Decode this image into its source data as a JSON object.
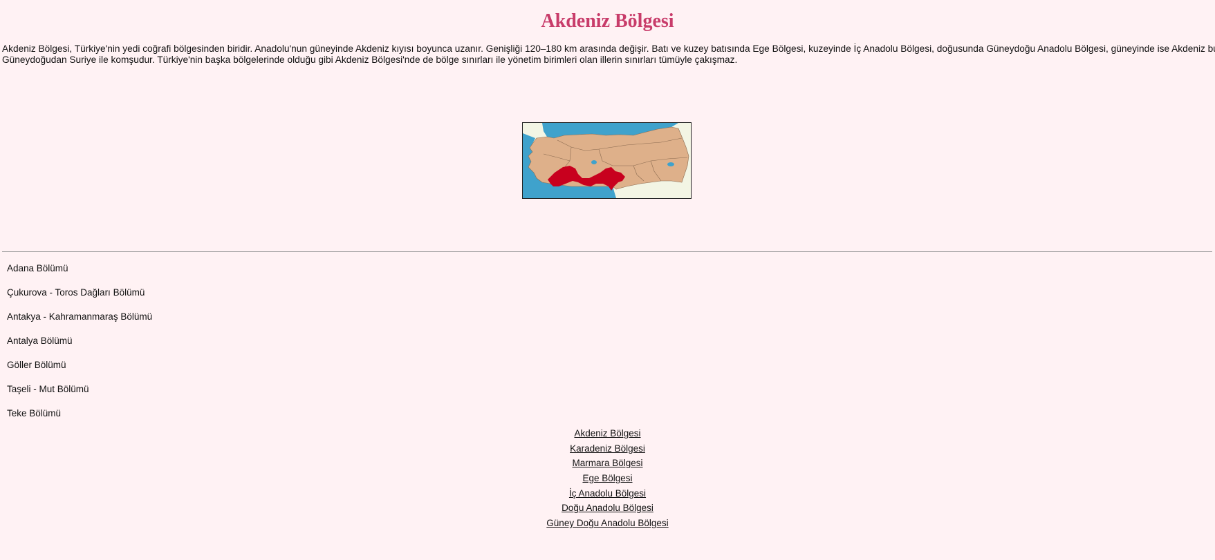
{
  "page": {
    "title": "Akdeniz Bölgesi",
    "intro_line1": "Akdeniz Bölgesi, Türkiye'nin yedi coğrafi bölgesinden biridir. Anadolu'nun güneyinde Akdeniz kıyısı boyunca uzanır. Genişliği 120–180 km arasında değişir. Batı ve kuzey batısında Ege Bölgesi, kuzeyinde İç Anadolu Bölgesi, doğusunda Güneydoğu Anadolu Bölgesi, güneyinde ise Akdeniz bulunur.",
    "intro_line2": "Güneydoğudan Suriye ile komşudur. Türkiye'nin başka bölgelerinde olduğu gibi Akdeniz Bölgesi'nde de bölge sınırları ile yönetim birimleri olan illerin sınırları tümüyle çakışmaz."
  },
  "map": {
    "colors": {
      "sea": "#3fa2cc",
      "land": "#deb08a",
      "highlight": "#c8001e",
      "neighbor": "#f3f5e4",
      "border": "#8a6a50"
    }
  },
  "sections": [
    "Adana Bölümü",
    "Çukurova - Toros Dağları Bölümü",
    "Antakya - Kahramanmaraş Bölümü",
    "Antalya Bölümü",
    "Göller Bölümü",
    "Taşeli - Mut Bölümü",
    "Teke Bölümü"
  ],
  "region_links": [
    "Akdeniz Bölgesi",
    "Karadeniz Bölgesi",
    "Marmara Bölgesi",
    "Ege Bölgesi",
    "İç Anadolu Bölgesi",
    "Doğu Anadolu Bölgesi",
    "Güney Doğu Anadolu Bölgesi"
  ]
}
